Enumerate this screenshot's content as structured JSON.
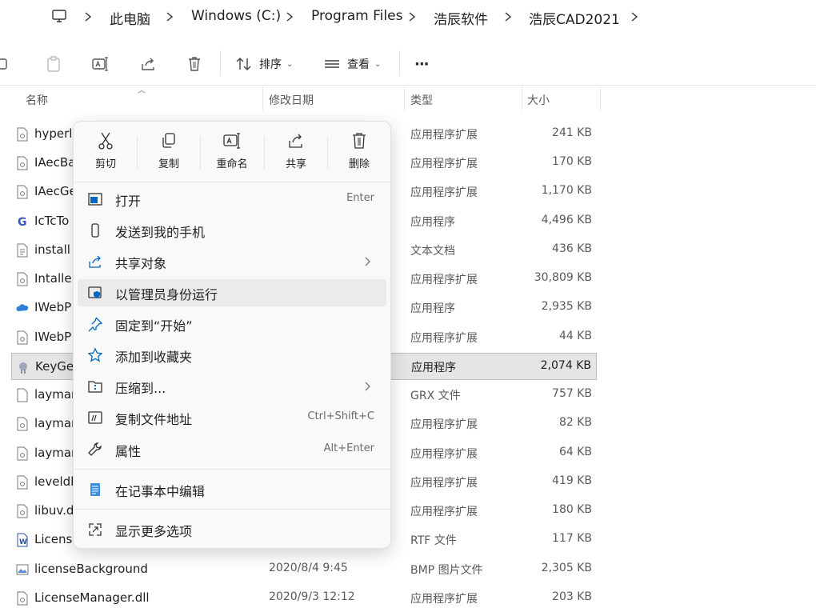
{
  "breadcrumb": [
    "此电脑",
    "Windows (C:)",
    "Program Files",
    "浩辰软件",
    "浩辰CAD2021"
  ],
  "toolbar": {
    "sort_label": "排序",
    "view_label": "查看",
    "more_label": "···"
  },
  "columns": {
    "name": "名称",
    "modified": "修改日期",
    "type": "类型",
    "size": "大小"
  },
  "files": [
    {
      "name": "hyperli",
      "date": "",
      "type": "应用程序扩展",
      "size": "241 KB"
    },
    {
      "name": "IAecBa",
      "date": "",
      "type": "应用程序扩展",
      "size": "170 KB"
    },
    {
      "name": "IAecGe",
      "date": "",
      "type": "应用程序扩展",
      "size": "1,170 KB"
    },
    {
      "name": "IcTcTo",
      "date": "",
      "type": "应用程序",
      "size": "4,496 KB"
    },
    {
      "name": "install",
      "date": "",
      "type": "文本文档",
      "size": "436 KB"
    },
    {
      "name": "Intaller",
      "date": "",
      "type": "应用程序扩展",
      "size": "30,809 KB"
    },
    {
      "name": "IWebP",
      "date": "",
      "type": "应用程序",
      "size": "2,935 KB"
    },
    {
      "name": "IWebP",
      "date": "",
      "type": "应用程序扩展",
      "size": "44 KB"
    },
    {
      "name": "KeyGe",
      "date": "",
      "type": "应用程序",
      "size": "2,074 KB"
    },
    {
      "name": "laymar",
      "date": "",
      "type": "GRX 文件",
      "size": "757 KB"
    },
    {
      "name": "laymar",
      "date": "",
      "type": "应用程序扩展",
      "size": "82 KB"
    },
    {
      "name": "laymar",
      "date": "",
      "type": "应用程序扩展",
      "size": "64 KB"
    },
    {
      "name": "leveldb",
      "date": "",
      "type": "应用程序扩展",
      "size": "419 KB"
    },
    {
      "name": "libuv.d",
      "date": "",
      "type": "应用程序扩展",
      "size": "180 KB"
    },
    {
      "name": "License",
      "date": "",
      "type": "RTF 文件",
      "size": "117 KB"
    },
    {
      "name": "licenseBackground",
      "date": "2020/8/4 9:45",
      "type": "BMP 图片文件",
      "size": "2,305 KB"
    },
    {
      "name": "LicenseManager.dll",
      "date": "2020/9/3 12:12",
      "type": "应用程序扩展",
      "size": "203 KB"
    }
  ],
  "context_menu": {
    "quick_actions": [
      "剪切",
      "复制",
      "重命名",
      "共享",
      "删除"
    ],
    "items": [
      {
        "label": "打开",
        "shortcut": "Enter"
      },
      {
        "label": "发送到我的手机",
        "shortcut": ""
      },
      {
        "label": "共享对象",
        "shortcut": ""
      },
      {
        "label": "以管理员身份运行",
        "shortcut": ""
      },
      {
        "label": "固定到“开始”",
        "shortcut": ""
      },
      {
        "label": "添加到收藏夹",
        "shortcut": ""
      },
      {
        "label": "压缩到...",
        "shortcut": ""
      },
      {
        "label": "复制文件地址",
        "shortcut": "Ctrl+Shift+C"
      },
      {
        "label": "属性",
        "shortcut": "Alt+Enter"
      },
      {
        "label": "在记事本中编辑",
        "shortcut": ""
      },
      {
        "label": "显示更多选项",
        "shortcut": ""
      }
    ]
  },
  "colors": {
    "accent": "#0067c0",
    "hover": "#ebebeb",
    "selected_row": "#e5e5e5"
  }
}
